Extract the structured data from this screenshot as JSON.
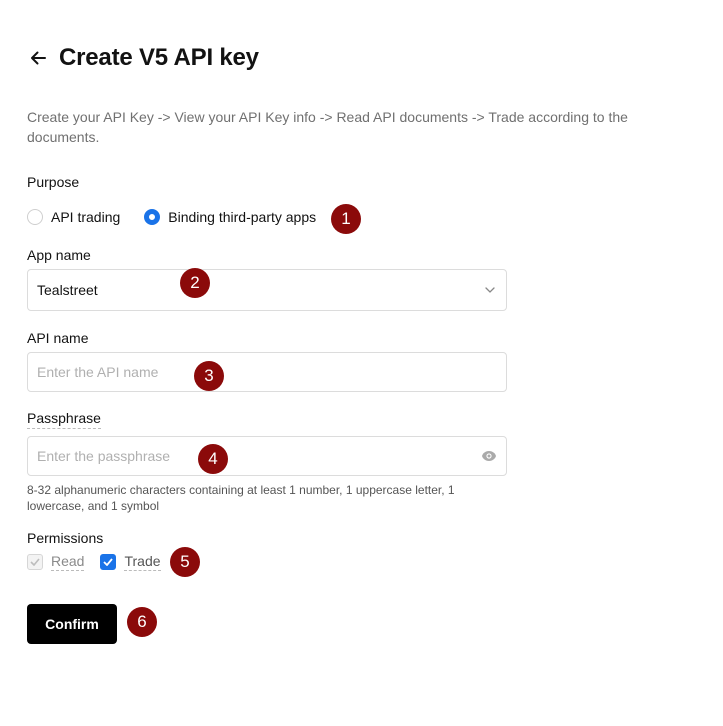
{
  "header": {
    "back_icon": "arrow-left-icon",
    "title": "Create V5 API key"
  },
  "description": "Create your API Key -> View your API Key info -> Read API documents -> Trade according to the documents.",
  "purpose": {
    "label": "Purpose",
    "options": [
      {
        "label": "API trading",
        "checked": false
      },
      {
        "label": "Binding third-party apps",
        "checked": true
      }
    ]
  },
  "app_name": {
    "label": "App name",
    "value": "Tealstreet",
    "icon": "chevron-down-icon"
  },
  "api_name": {
    "label": "API name",
    "placeholder": "Enter the API name",
    "value": ""
  },
  "passphrase": {
    "label": "Passphrase",
    "placeholder": "Enter the passphrase",
    "value": "",
    "icon": "eye-icon",
    "hint": "8-32 alphanumeric characters containing at least 1 number, 1 uppercase letter, 1 lowercase, and 1 symbol"
  },
  "permissions": {
    "label": "Permissions",
    "options": [
      {
        "label": "Read",
        "checked": true,
        "disabled": true
      },
      {
        "label": "Trade",
        "checked": true,
        "disabled": false
      }
    ]
  },
  "confirm_label": "Confirm",
  "annotations": [
    "1",
    "2",
    "3",
    "4",
    "5",
    "6"
  ],
  "colors": {
    "accent": "#1a73e8",
    "badge": "#8b0a0a",
    "primary_button": "#000000"
  }
}
